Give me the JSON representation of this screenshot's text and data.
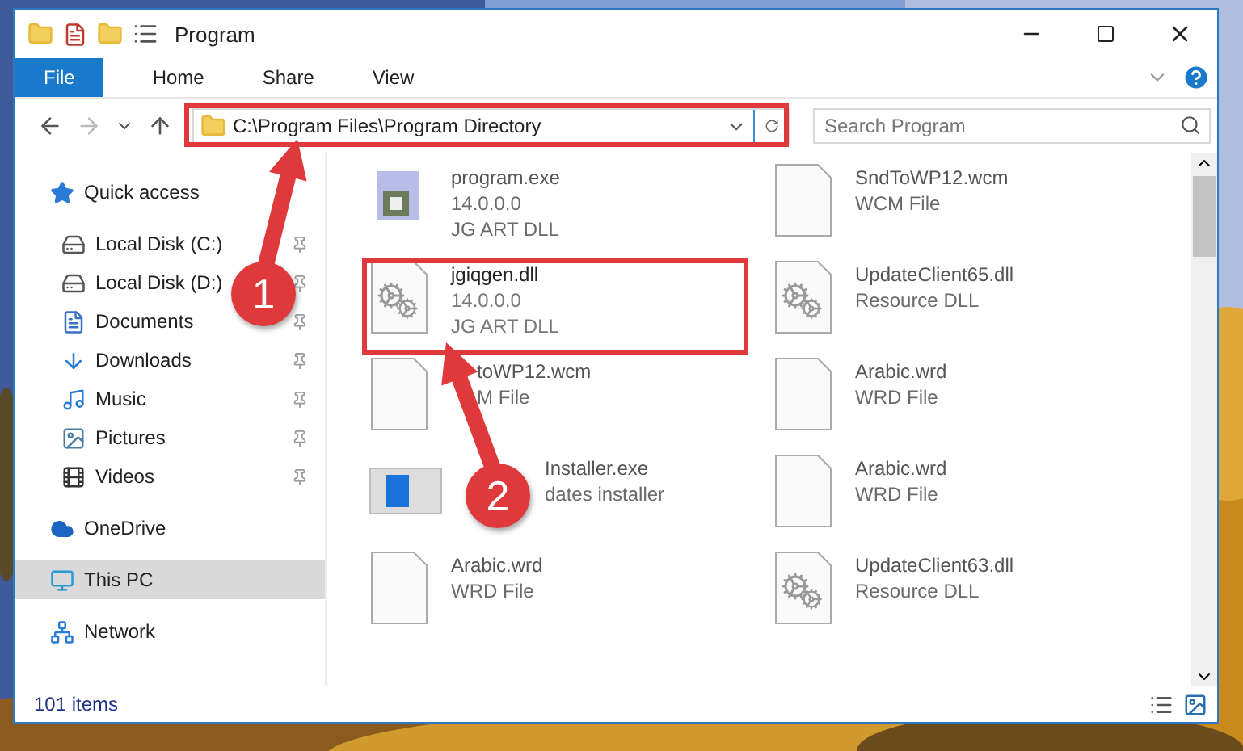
{
  "window": {
    "title": "Program"
  },
  "ribbon_tabs": [
    {
      "label": "File",
      "selected": true
    },
    {
      "label": "Home",
      "selected": false
    },
    {
      "label": "Share",
      "selected": false
    },
    {
      "label": "View",
      "selected": false
    }
  ],
  "address": {
    "path": "C:\\Program Files\\Program Directory"
  },
  "search": {
    "placeholder": "Search Program"
  },
  "sidebar": {
    "items": [
      {
        "label": "Quick access",
        "kind": "star",
        "selected": false,
        "children": [
          {
            "label": "Local Disk (C:)",
            "kind": "disk",
            "pinned": true,
            "selected": false
          },
          {
            "label": "Local Disk (D:)",
            "kind": "disk",
            "pinned": true,
            "selected": false
          },
          {
            "label": "Documents",
            "kind": "document",
            "pinned": true,
            "selected": false
          },
          {
            "label": "Downloads",
            "kind": "download",
            "pinned": true,
            "selected": false
          },
          {
            "label": "Music",
            "kind": "music",
            "pinned": true,
            "selected": false
          },
          {
            "label": "Pictures",
            "kind": "pictures",
            "pinned": true,
            "selected": false
          },
          {
            "label": "Videos",
            "kind": "videos",
            "pinned": true,
            "selected": false
          }
        ]
      },
      {
        "label": "OneDrive",
        "kind": "cloud",
        "selected": false
      },
      {
        "label": "This PC",
        "kind": "pc",
        "selected": true
      },
      {
        "label": "Network",
        "kind": "network",
        "selected": false
      }
    ]
  },
  "files": [
    {
      "name": "program.exe",
      "details": [
        "14.0.0.0",
        "JG ART DLL"
      ],
      "kind": "exe",
      "faded": true
    },
    {
      "name": "SndToWP12.wcm",
      "details": [
        "WCM File"
      ],
      "kind": "blank",
      "faded": true
    },
    {
      "name": "jgiqgen.dll",
      "details": [
        "14.0.0.0",
        "JG ART DLL"
      ],
      "kind": "dll",
      "faded": false
    },
    {
      "name": "UpdateClient65.dll",
      "details": [
        "Resource DLL"
      ],
      "kind": "dll",
      "faded": true
    },
    {
      "name": "toWP12.wcm",
      "details": [
        "M File"
      ],
      "kind": "blank",
      "faded": true,
      "under_arrow": true
    },
    {
      "name": "Arabic.wrd",
      "details": [
        "WRD File"
      ],
      "kind": "blank",
      "faded": true
    },
    {
      "name": "Installer.exe",
      "details": [
        "dates installer"
      ],
      "kind": "installer",
      "faded": true,
      "under_badge": true
    },
    {
      "name": "Arabic.wrd",
      "details": [
        "WRD File"
      ],
      "kind": "blank",
      "faded": true
    },
    {
      "name": "Arabic.wrd",
      "details": [
        "WRD File"
      ],
      "kind": "blank",
      "faded": true
    },
    {
      "name": "UpdateClient63.dll",
      "details": [
        "Resource DLL"
      ],
      "kind": "dll",
      "faded": true
    }
  ],
  "status_bar": {
    "count": "101 items"
  },
  "annotations": [
    {
      "label": "1"
    },
    {
      "label": "2"
    }
  ]
}
